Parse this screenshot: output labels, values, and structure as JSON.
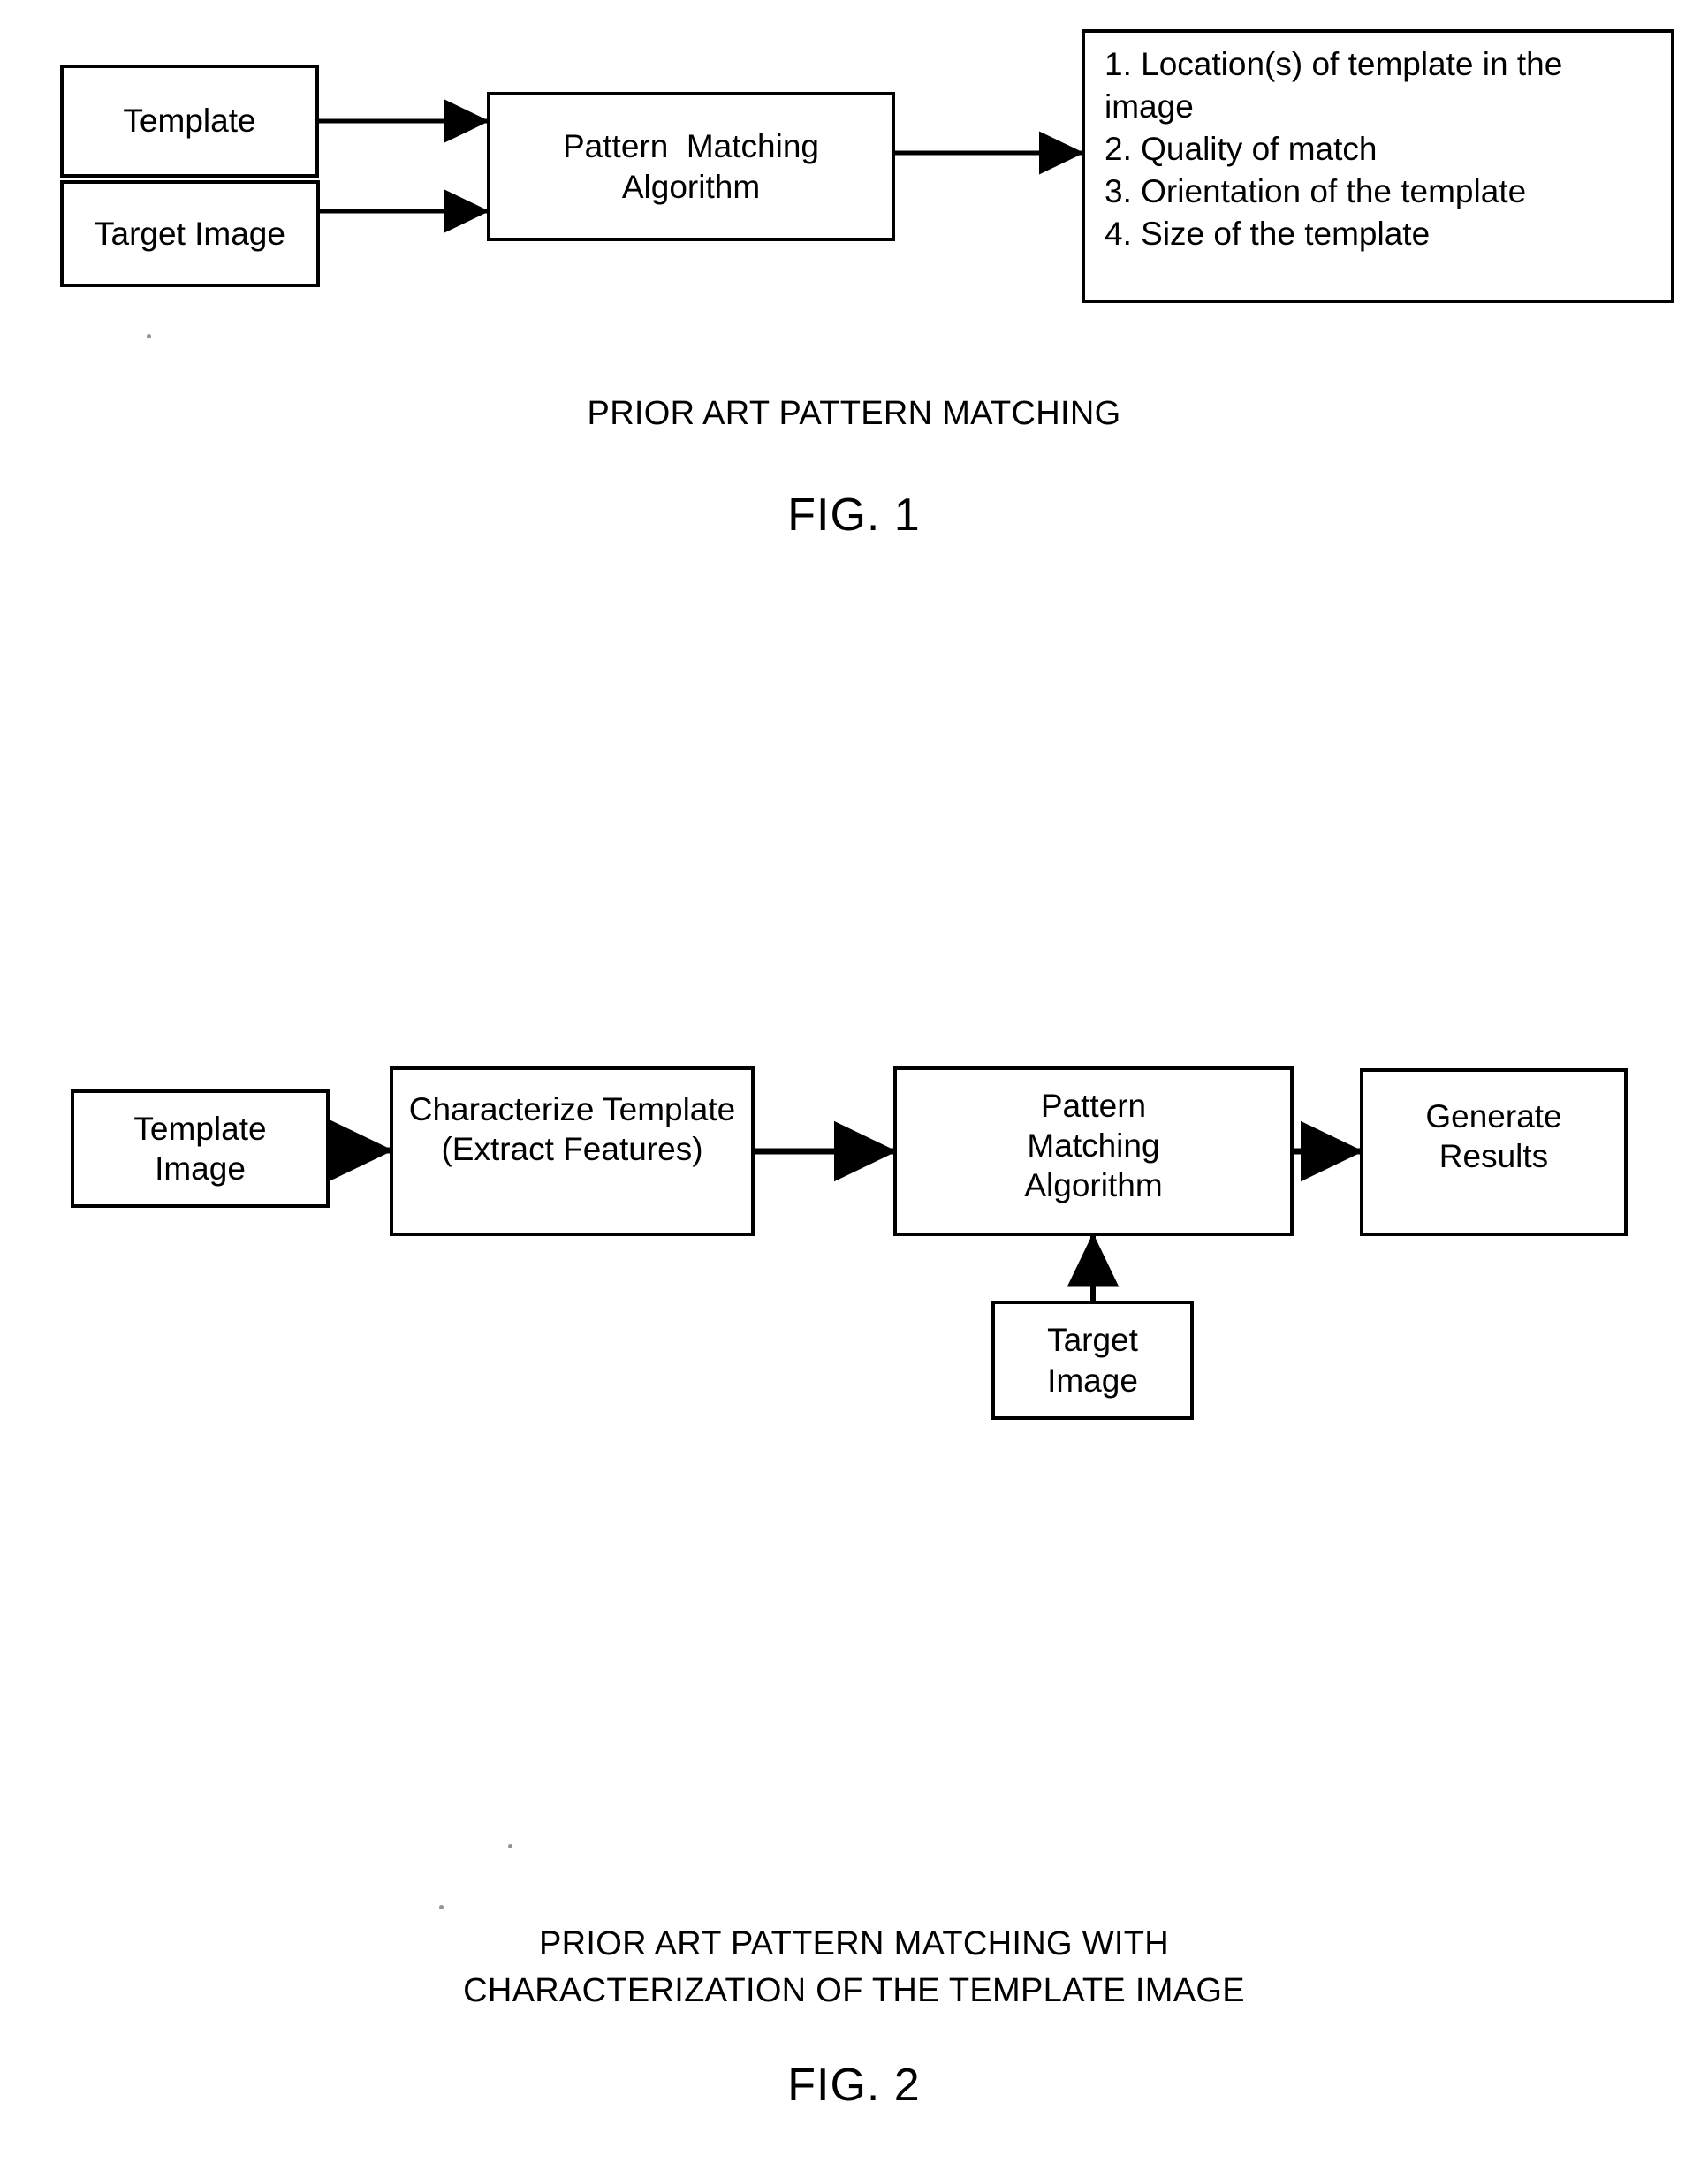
{
  "document": {
    "type": "patent-figure-sheet",
    "background_color": "#ffffff",
    "ink_color": "#000000"
  },
  "figure1": {
    "nodes": {
      "template": {
        "lines": [
          "Template"
        ]
      },
      "target_image": {
        "lines": [
          "Target Image"
        ]
      },
      "pattern_matching": {
        "lines": [
          "Pattern  Matching",
          "Algorithm"
        ]
      },
      "results": {
        "lines": [
          "1. Location(s) of template in the",
          "image",
          "2. Quality of match",
          "3. Orientation of the template",
          "4. Size of the template"
        ]
      }
    },
    "caption": "PRIOR ART PATTERN MATCHING",
    "label": "FIG. 1"
  },
  "figure2": {
    "nodes": {
      "template_image": {
        "lines": [
          "Template",
          "Image"
        ]
      },
      "characterize_template": {
        "lines": [
          "Characterize Template",
          "(Extract Features)"
        ]
      },
      "pattern_matching": {
        "lines": [
          "Pattern",
          "Matching",
          "Algorithm"
        ]
      },
      "generate_results": {
        "lines": [
          "Generate",
          "Results"
        ]
      },
      "target_image": {
        "lines": [
          "Target",
          "Image"
        ]
      }
    },
    "caption_line1": "PRIOR ART PATTERN MATCHING WITH",
    "caption_line2": "CHARACTERIZATION OF THE TEMPLATE IMAGE",
    "label": "FIG. 2"
  }
}
